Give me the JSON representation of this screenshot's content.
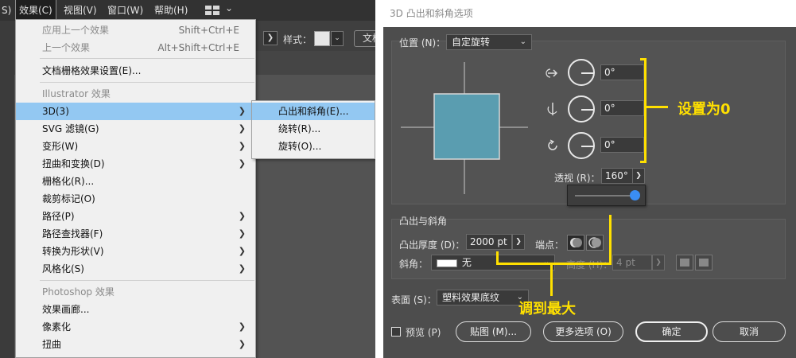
{
  "menubar": {
    "items": [
      "S)",
      "效果(C)",
      "视图(V)",
      "窗口(W)",
      "帮助(H)"
    ]
  },
  "toolbar": {
    "style_label": "样式：",
    "doc_label": "文档"
  },
  "effect_menu": {
    "apply_last": {
      "label": "应用上一个效果",
      "shortcut": "Shift+Ctrl+E"
    },
    "last": {
      "label": "上一个效果",
      "shortcut": "Alt+Shift+Ctrl+E"
    },
    "raster_settings": "文档栅格效果设置(E)...",
    "illustrator_header": "Illustrator 效果",
    "illustrator_items": [
      "3D(3)",
      "SVG 滤镜(G)",
      "变形(W)",
      "扭曲和变换(D)",
      "栅格化(R)...",
      "裁剪标记(O)",
      "路径(P)",
      "路径查找器(F)",
      "转换为形状(V)",
      "风格化(S)"
    ],
    "photoshop_header": "Photoshop 效果",
    "photoshop_items": [
      "效果画廊...",
      "像素化",
      "扭曲"
    ]
  },
  "submenu_3d": {
    "items": [
      "凸出和斜角(E)...",
      "绕转(R)...",
      "旋转(O)..."
    ]
  },
  "dialog": {
    "title": "3D 凸出和斜角选项",
    "position_label": "位置 (N)：",
    "position_value": "自定旋转",
    "rotation_x": "0°",
    "rotation_y": "0°",
    "rotation_z": "0°",
    "perspective_label": "透视 (R)：",
    "perspective_value": "160°",
    "perspective_slider_value": 1.0,
    "extrude_section": "凸出与斜角",
    "extrude_depth_label": "凸出厚度 (D)：",
    "extrude_depth_value": "2000 pt",
    "cap_label": "端点：",
    "bevel_label": "斜角：",
    "bevel_value": "无",
    "height_label": "高度 (H)：",
    "height_value": "4 pt",
    "surface_label": "表面 (S)：",
    "surface_value": "塑料效果底纹",
    "preview_label": "预览 (P)",
    "map_button": "贴图 (M)...",
    "more_options_button": "更多选项 (O)",
    "ok_button": "确定",
    "cancel_button": "取消"
  },
  "annotations": {
    "set_zero": "设置为0",
    "max_out": "调到最大"
  },
  "colors": {
    "annotation": "#ffe000",
    "cube_face": "#5a9db0",
    "menu_highlight": "#93c8f2",
    "slider_knob": "#3a8df3"
  }
}
